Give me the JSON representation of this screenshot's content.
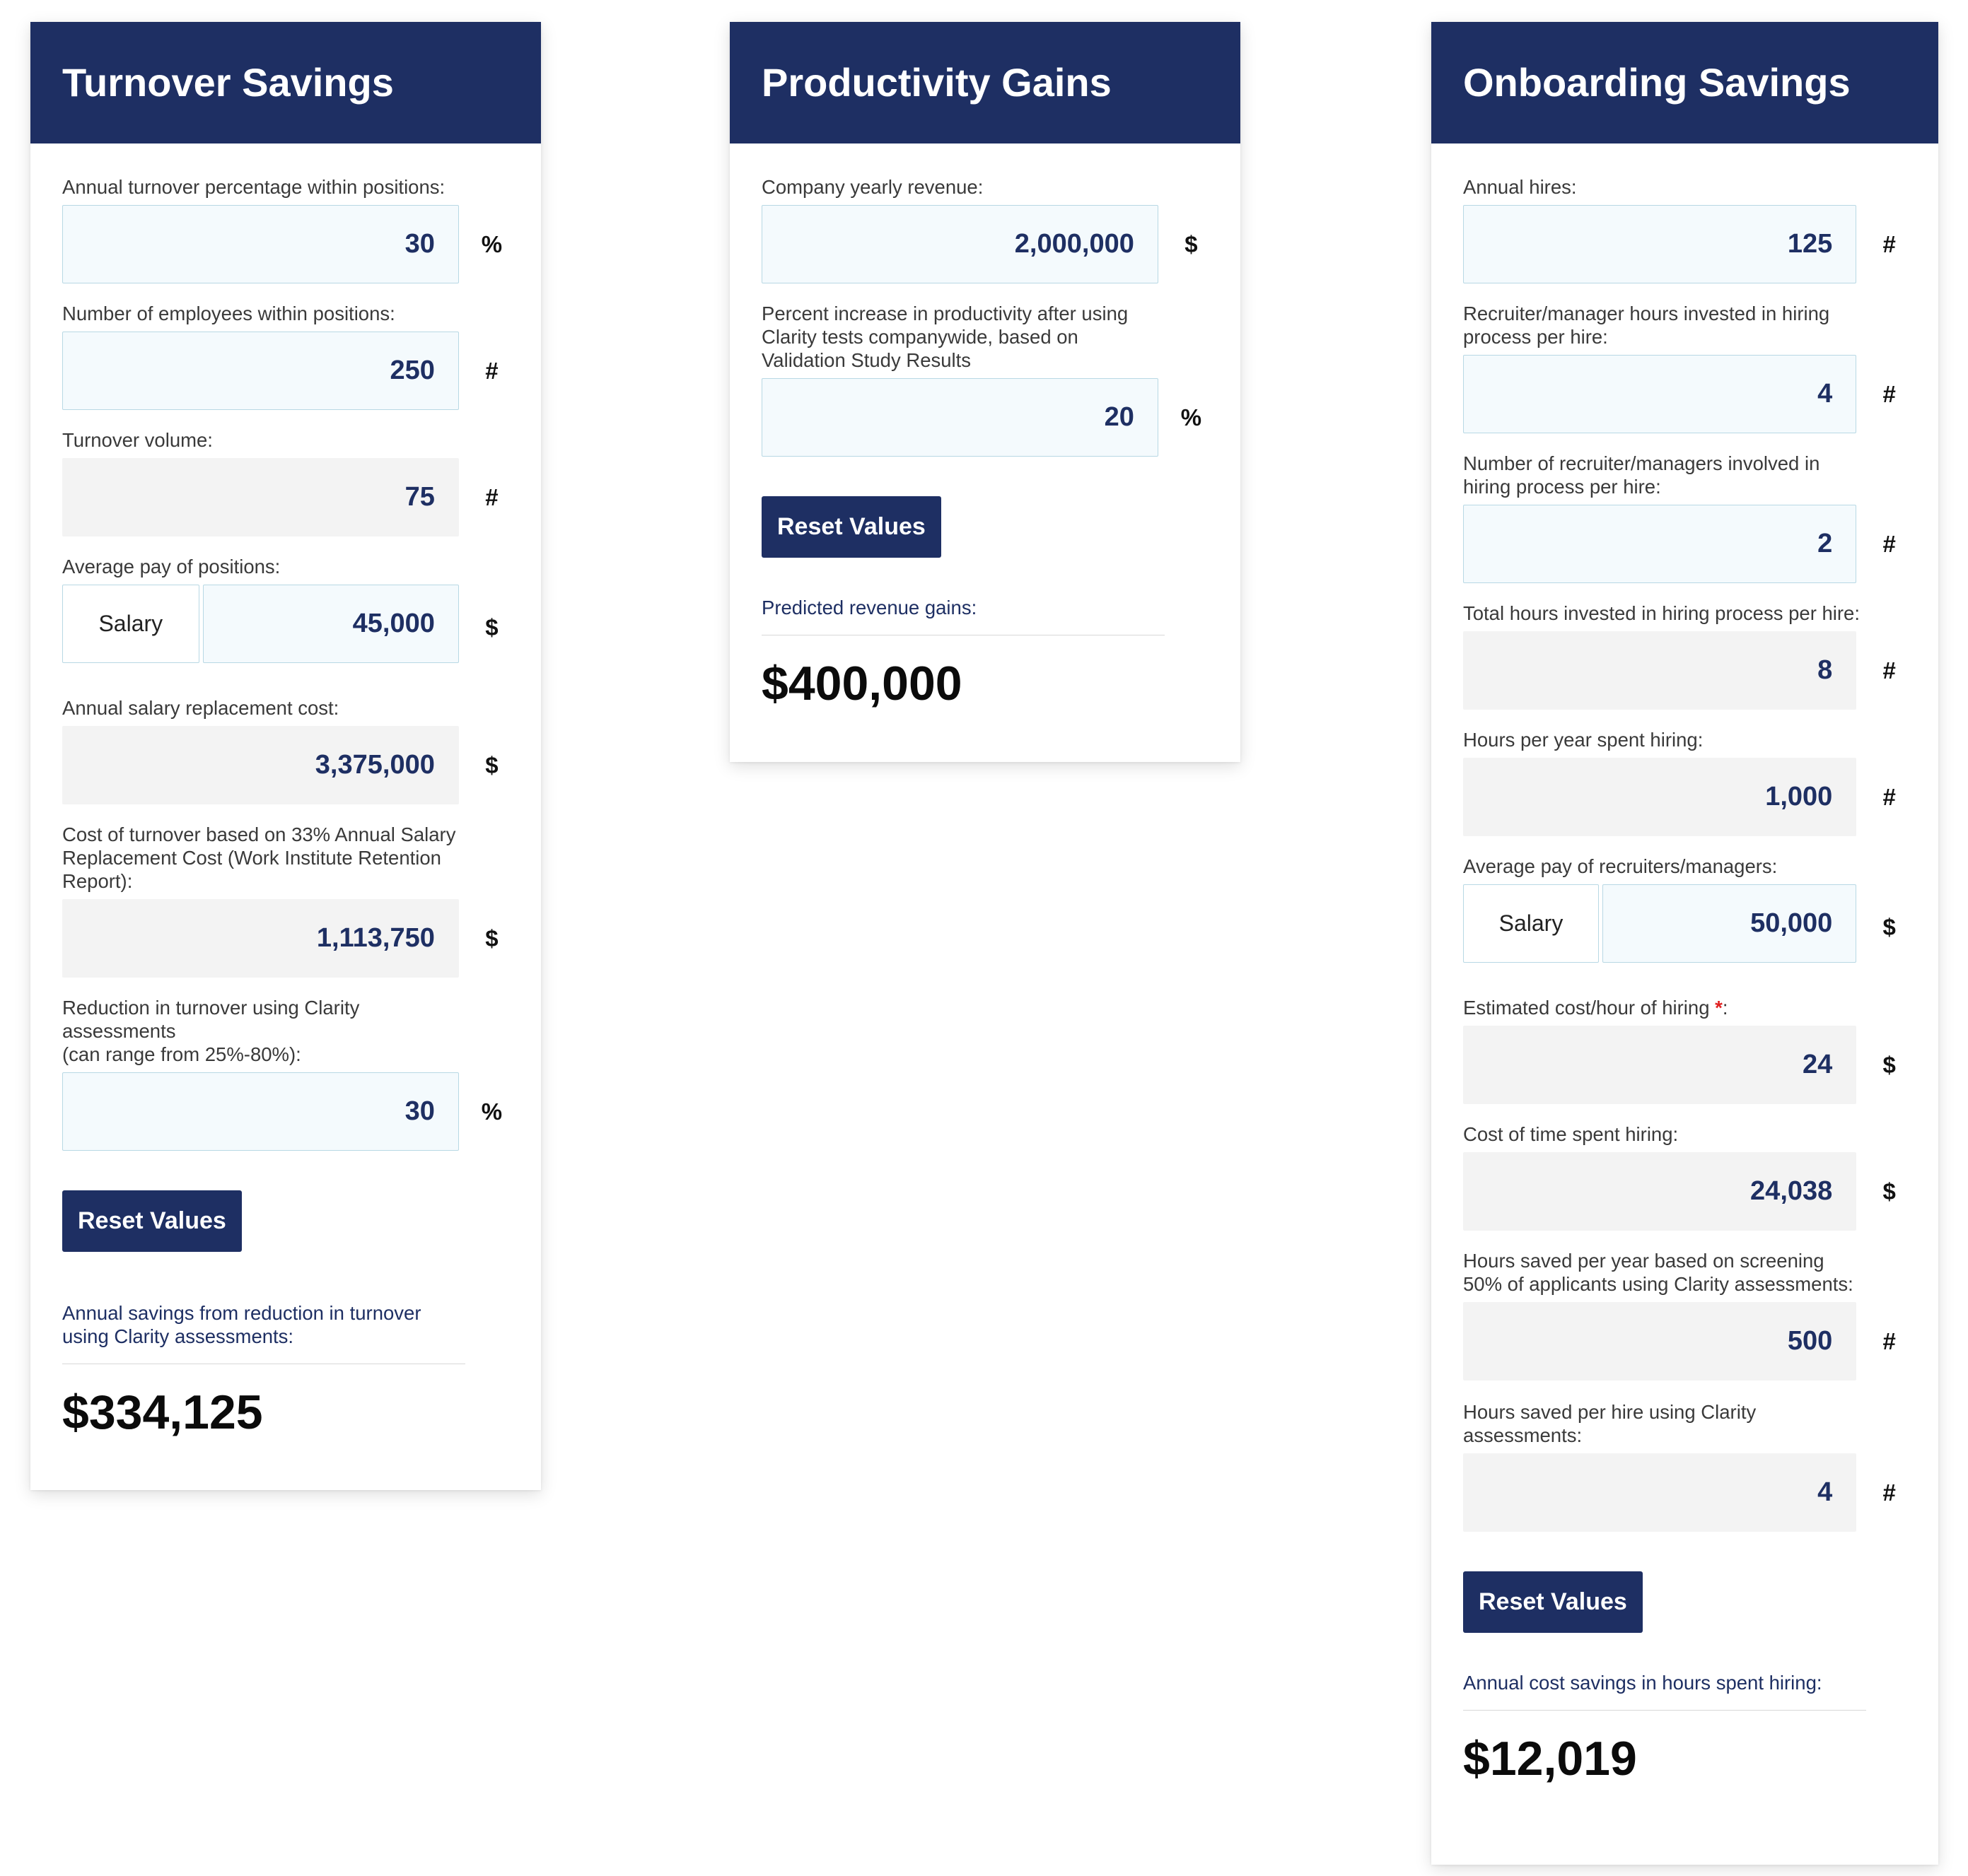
{
  "turnover": {
    "title": "Turnover Savings",
    "fields": [
      {
        "label": "Annual turnover percentage within positions:",
        "value": "30",
        "unit": "%",
        "editable": true
      },
      {
        "label": "Number of employees within positions:",
        "value": "250",
        "unit": "#",
        "editable": true
      },
      {
        "label": "Turnover volume:",
        "value": "75",
        "unit": "#",
        "editable": false
      },
      {
        "label": "Average pay of positions:",
        "pay_type": "Salary",
        "value": "45,000",
        "unit": "$",
        "editable": true
      },
      {
        "label": "Annual salary replacement cost:",
        "value": "3,375,000",
        "unit": "$",
        "editable": false
      },
      {
        "label": "Cost of turnover based on 33% Annual Salary Replacement Cost (Work Institute Retention Report):",
        "value": "1,113,750",
        "unit": "$",
        "editable": false
      },
      {
        "label_line1": "Reduction in turnover using Clarity assessments",
        "label_line2": "(can range from 25%-80%):",
        "value": "30",
        "unit": "%",
        "editable": true
      }
    ],
    "reset_label": "Reset Values",
    "result_label": "Annual savings from reduction in turnover using Clarity assessments:",
    "result_value": "$334,125"
  },
  "productivity": {
    "title": "Productivity Gains",
    "fields": [
      {
        "label": "Company yearly revenue:",
        "value": "2,000,000",
        "unit": "$",
        "editable": true
      },
      {
        "label": "Percent increase in productivity after using Clarity tests companywide, based on Validation Study Results",
        "value": "20",
        "unit": "%",
        "editable": true
      }
    ],
    "reset_label": "Reset Values",
    "result_label": "Predicted revenue gains:",
    "result_value": "$400,000"
  },
  "onboarding": {
    "title": "Onboarding Savings",
    "fields": [
      {
        "label": "Annual hires:",
        "value": "125",
        "unit": "#",
        "editable": true
      },
      {
        "label": "Recruiter/manager hours invested in hiring process per hire:",
        "value": "4",
        "unit": "#",
        "editable": true
      },
      {
        "label": "Number of recruiter/managers involved in hiring process per hire:",
        "value": "2",
        "unit": "#",
        "editable": true
      },
      {
        "label": "Total hours invested in hiring process per hire:",
        "value": "8",
        "unit": "#",
        "editable": false
      },
      {
        "label": "Hours per year spent hiring:",
        "value": "1,000",
        "unit": "#",
        "editable": false
      },
      {
        "label": "Average pay of recruiters/managers:",
        "pay_type": "Salary",
        "value": "50,000",
        "unit": "$",
        "editable": true
      },
      {
        "label": "Estimated cost/hour of hiring",
        "label_marker": "*",
        "label_suffix": ":",
        "value": "24",
        "unit": "$",
        "editable": false
      },
      {
        "label": "Cost of time spent hiring:",
        "value": "24,038",
        "unit": "$",
        "editable": false
      },
      {
        "label": "Hours saved per year based on screening 50% of applicants using Clarity assessments:",
        "value": "500",
        "unit": "#",
        "editable": false
      },
      {
        "label": "Hours saved per hire using Clarity assessments:",
        "value": "4",
        "unit": "#",
        "editable": false
      }
    ],
    "reset_label": "Reset Values",
    "result_label": "Annual cost savings in hours spent hiring:",
    "result_value": "$12,019"
  }
}
